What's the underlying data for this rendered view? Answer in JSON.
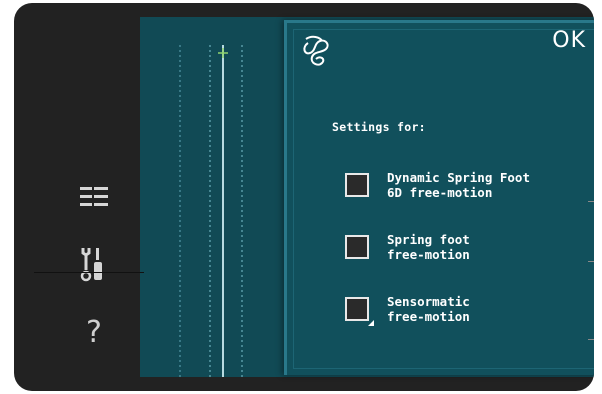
{
  "popup": {
    "ok_label": "OK",
    "title": "Settings for:",
    "options": [
      {
        "line1": "Dynamic Spring Foot",
        "line2": "6D free-motion",
        "checked": false
      },
      {
        "line1": "Spring foot",
        "line2": "free-motion",
        "checked": false
      },
      {
        "line1": "Sensormatic",
        "line2": "free-motion",
        "checked": false
      }
    ]
  },
  "sidebar": {
    "help_label": "?"
  },
  "colors": {
    "bezel": "#222222",
    "stitch_area": "#114a55",
    "popup_bg": "#11505c",
    "popup_border": "#29788a",
    "checkbox_fill": "#2a2a2a"
  },
  "icons": [
    "free-motion-icon",
    "menu-icon",
    "tools-icon",
    "help-icon"
  ]
}
